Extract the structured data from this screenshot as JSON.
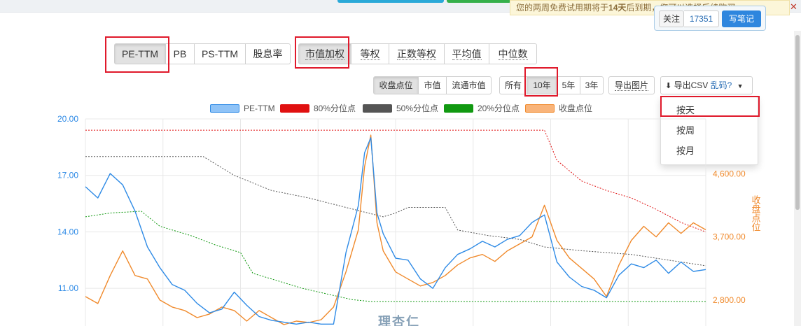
{
  "notice": {
    "prefix": "您的两周免费试用期将于",
    "days": "14天",
    "suffix": "后到期，您可以选择后续购买。"
  },
  "follow": {
    "follow_label": "关注",
    "count": "17351",
    "write_note_label": "写笔记"
  },
  "metric_tabs": [
    "PE-TTM",
    "PB",
    "PS-TTM",
    "股息率"
  ],
  "weight_tabs": [
    "市值加权",
    "等权",
    "正数等权",
    "平均值",
    "中位数"
  ],
  "price_tabs": [
    "收盘点位",
    "市值",
    "流通市值"
  ],
  "period_tabs": [
    "所有",
    "10年",
    "5年",
    "3年"
  ],
  "export_image_label": "导出图片",
  "export_csv": {
    "label": "导出CSV",
    "garbled_label": "乱码?"
  },
  "export_menu": [
    "按天",
    "按周",
    "按月"
  ],
  "watermark": "理杏仁",
  "colors": {
    "pe": "#2f8be6",
    "p80": "#e01010",
    "p50": "#555555",
    "p20": "#119911",
    "price": "#f08a2c"
  },
  "chart_data": {
    "type": "line",
    "legend": [
      "PE-TTM",
      "80%分位点",
      "50%分位点",
      "20%分位点",
      "收盘点位"
    ],
    "y_left": {
      "ticks": [
        "11.00",
        "14.00",
        "17.00",
        "20.00"
      ],
      "range": [
        9.0,
        20.0
      ]
    },
    "y_right": {
      "ticks": [
        "2,800.00",
        "3,700.00",
        "4,600.00"
      ],
      "label": "收盘点位",
      "range": [
        2430,
        5380
      ]
    },
    "x_range": [
      0,
      1
    ],
    "series": [
      {
        "name": "PE-TTM",
        "axis": "left",
        "points": [
          [
            0.0,
            16.4
          ],
          [
            0.02,
            15.8
          ],
          [
            0.04,
            17.1
          ],
          [
            0.06,
            16.5
          ],
          [
            0.08,
            15.1
          ],
          [
            0.1,
            13.2
          ],
          [
            0.12,
            12.1
          ],
          [
            0.14,
            11.2
          ],
          [
            0.16,
            10.9
          ],
          [
            0.18,
            10.2
          ],
          [
            0.2,
            9.7
          ],
          [
            0.22,
            9.9
          ],
          [
            0.24,
            10.8
          ],
          [
            0.26,
            10.1
          ],
          [
            0.28,
            9.5
          ],
          [
            0.3,
            9.3
          ],
          [
            0.32,
            9.2
          ],
          [
            0.34,
            9.1
          ],
          [
            0.36,
            9.2
          ],
          [
            0.38,
            9.1
          ],
          [
            0.4,
            9.1
          ],
          [
            0.42,
            12.9
          ],
          [
            0.44,
            15.4
          ],
          [
            0.45,
            18.2
          ],
          [
            0.46,
            19.0
          ],
          [
            0.47,
            15.0
          ],
          [
            0.48,
            13.9
          ],
          [
            0.5,
            12.6
          ],
          [
            0.52,
            12.5
          ],
          [
            0.54,
            11.5
          ],
          [
            0.56,
            11.0
          ],
          [
            0.58,
            12.1
          ],
          [
            0.6,
            12.8
          ],
          [
            0.62,
            13.1
          ],
          [
            0.64,
            13.5
          ],
          [
            0.66,
            13.2
          ],
          [
            0.68,
            13.6
          ],
          [
            0.7,
            13.8
          ],
          [
            0.72,
            14.5
          ],
          [
            0.74,
            14.9
          ],
          [
            0.76,
            12.4
          ],
          [
            0.78,
            11.6
          ],
          [
            0.8,
            11.1
          ],
          [
            0.82,
            10.9
          ],
          [
            0.84,
            10.5
          ],
          [
            0.86,
            11.7
          ],
          [
            0.88,
            12.3
          ],
          [
            0.9,
            12.1
          ],
          [
            0.92,
            12.5
          ],
          [
            0.94,
            11.8
          ],
          [
            0.96,
            12.4
          ],
          [
            0.98,
            11.9
          ],
          [
            1.0,
            12.0
          ]
        ]
      },
      {
        "name": "80%分位点",
        "axis": "left",
        "points": [
          [
            0.0,
            19.4
          ],
          [
            0.3,
            19.4
          ],
          [
            0.52,
            19.4
          ],
          [
            0.74,
            19.4
          ],
          [
            0.76,
            17.8
          ],
          [
            0.8,
            16.7
          ],
          [
            0.84,
            16.2
          ],
          [
            0.88,
            15.8
          ],
          [
            0.92,
            15.2
          ],
          [
            0.96,
            14.5
          ],
          [
            1.0,
            14.0
          ]
        ]
      },
      {
        "name": "50%分位点",
        "axis": "left",
        "points": [
          [
            0.0,
            18.0
          ],
          [
            0.19,
            18.0
          ],
          [
            0.24,
            17.0
          ],
          [
            0.3,
            16.2
          ],
          [
            0.36,
            15.8
          ],
          [
            0.42,
            15.3
          ],
          [
            0.48,
            14.8
          ],
          [
            0.5,
            15.0
          ],
          [
            0.52,
            15.3
          ],
          [
            0.58,
            15.3
          ],
          [
            0.6,
            14.1
          ],
          [
            0.65,
            13.8
          ],
          [
            0.7,
            13.6
          ],
          [
            0.74,
            13.2
          ],
          [
            0.8,
            13.0
          ],
          [
            0.88,
            12.8
          ],
          [
            0.94,
            12.5
          ],
          [
            1.0,
            12.2
          ]
        ]
      },
      {
        "name": "20%分位点",
        "axis": "left",
        "points": [
          [
            0.0,
            14.8
          ],
          [
            0.04,
            15.0
          ],
          [
            0.09,
            15.1
          ],
          [
            0.12,
            14.3
          ],
          [
            0.17,
            13.8
          ],
          [
            0.21,
            13.3
          ],
          [
            0.25,
            12.9
          ],
          [
            0.27,
            11.8
          ],
          [
            0.31,
            11.4
          ],
          [
            0.35,
            11.0
          ],
          [
            0.39,
            10.7
          ],
          [
            0.43,
            10.4
          ],
          [
            0.46,
            10.3
          ],
          [
            0.6,
            10.3
          ],
          [
            0.8,
            10.3
          ],
          [
            1.0,
            10.3
          ]
        ]
      },
      {
        "name": "收盘点位",
        "axis": "right",
        "points": [
          [
            0.0,
            2850
          ],
          [
            0.02,
            2750
          ],
          [
            0.04,
            3150
          ],
          [
            0.06,
            3500
          ],
          [
            0.08,
            3150
          ],
          [
            0.1,
            3100
          ],
          [
            0.12,
            2800
          ],
          [
            0.14,
            2700
          ],
          [
            0.16,
            2650
          ],
          [
            0.18,
            2550
          ],
          [
            0.2,
            2600
          ],
          [
            0.22,
            2700
          ],
          [
            0.24,
            2650
          ],
          [
            0.26,
            2500
          ],
          [
            0.28,
            2650
          ],
          [
            0.3,
            2550
          ],
          [
            0.32,
            2450
          ],
          [
            0.34,
            2500
          ],
          [
            0.36,
            2480
          ],
          [
            0.38,
            2520
          ],
          [
            0.4,
            2700
          ],
          [
            0.42,
            3200
          ],
          [
            0.44,
            3800
          ],
          [
            0.45,
            4700
          ],
          [
            0.46,
            5150
          ],
          [
            0.47,
            3900
          ],
          [
            0.48,
            3500
          ],
          [
            0.5,
            3200
          ],
          [
            0.52,
            3100
          ],
          [
            0.54,
            3000
          ],
          [
            0.56,
            3050
          ],
          [
            0.58,
            3150
          ],
          [
            0.6,
            3300
          ],
          [
            0.62,
            3400
          ],
          [
            0.64,
            3450
          ],
          [
            0.66,
            3350
          ],
          [
            0.68,
            3500
          ],
          [
            0.7,
            3600
          ],
          [
            0.72,
            3700
          ],
          [
            0.74,
            4150
          ],
          [
            0.76,
            3650
          ],
          [
            0.78,
            3400
          ],
          [
            0.8,
            3250
          ],
          [
            0.82,
            3100
          ],
          [
            0.84,
            2850
          ],
          [
            0.86,
            3300
          ],
          [
            0.88,
            3650
          ],
          [
            0.9,
            3850
          ],
          [
            0.92,
            3700
          ],
          [
            0.94,
            3900
          ],
          [
            0.96,
            3750
          ],
          [
            0.98,
            3900
          ],
          [
            1.0,
            3800
          ]
        ]
      }
    ]
  }
}
